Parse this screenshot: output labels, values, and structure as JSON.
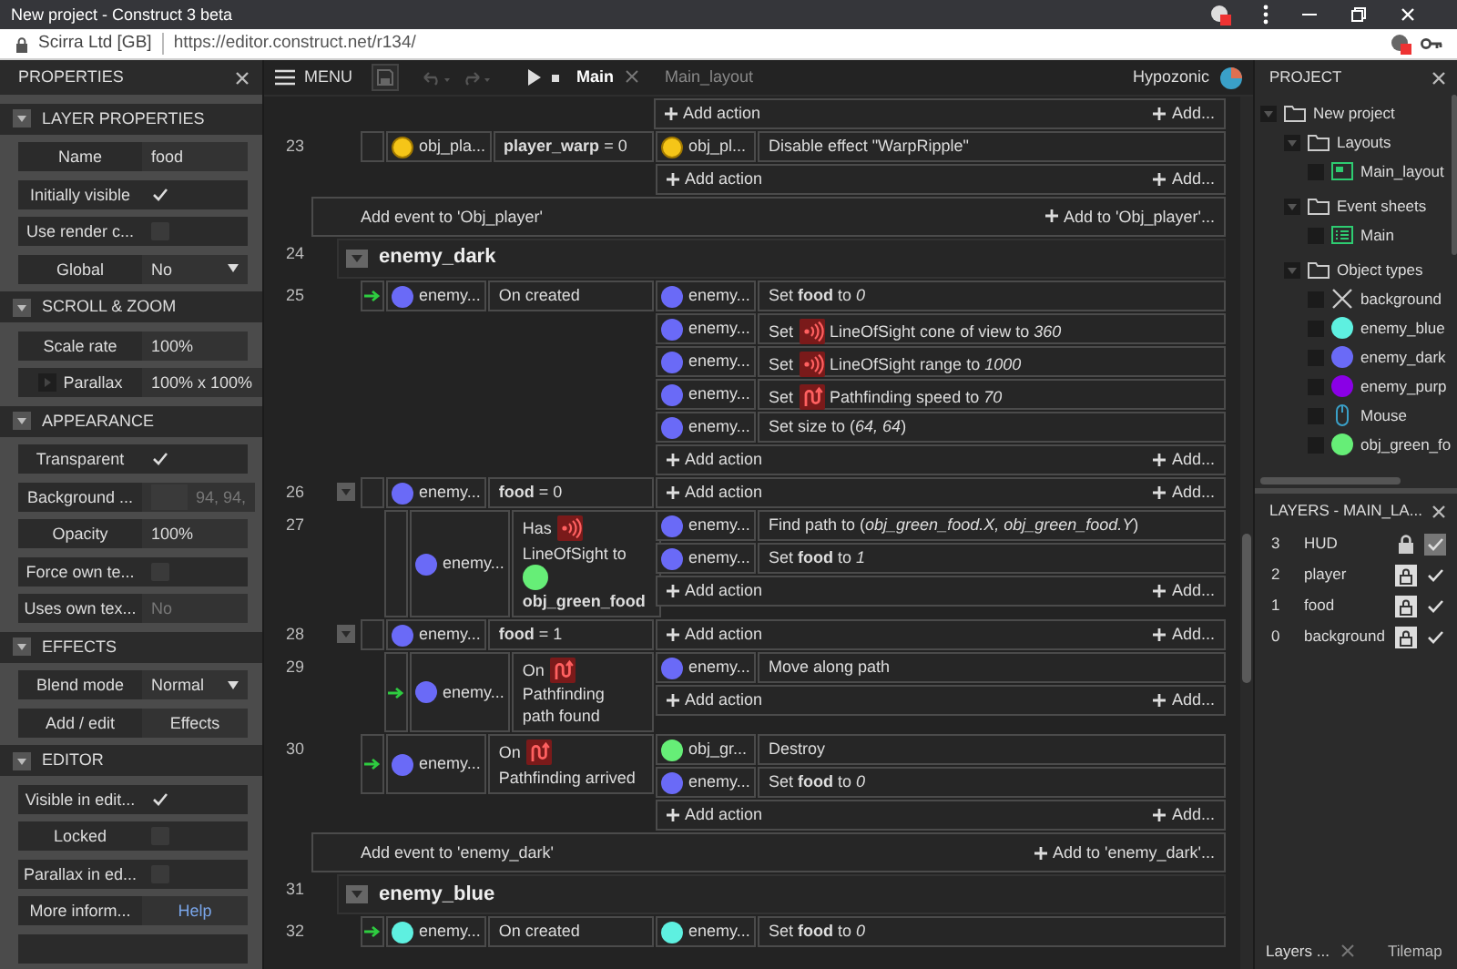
{
  "browser": {
    "title": "New project - Construct 3 beta",
    "site": "Scirra Ltd [GB]",
    "url": "https://editor.construct.net/r134/"
  },
  "properties": {
    "title": "PROPERTIES",
    "sections": [
      {
        "title": "LAYER PROPERTIES",
        "expanded": true,
        "rows": [
          {
            "kind": "text",
            "label": "Name",
            "value": "food",
            "disabled": false
          },
          {
            "kind": "check",
            "label": "Initially visible",
            "checked": true,
            "disabled": false
          },
          {
            "kind": "check",
            "label": "Use render c...",
            "checked": false,
            "disabled": false
          },
          {
            "kind": "select",
            "label": "Global",
            "value": "No",
            "disabled": false
          }
        ]
      },
      {
        "title": "SCROLL & ZOOM",
        "expanded": true,
        "rows": [
          {
            "kind": "text",
            "label": "Scale rate",
            "value": "100%",
            "disabled": false
          },
          {
            "kind": "group",
            "label": "Parallax",
            "value": "100% x 100%",
            "expanded": false,
            "disabled": false
          }
        ]
      },
      {
        "title": "APPEARANCE",
        "expanded": true,
        "rows": [
          {
            "kind": "check",
            "label": "Transparent",
            "checked": true,
            "disabled": false
          },
          {
            "kind": "color",
            "label": "Background ...",
            "value": "94, 94,",
            "disabled": true
          },
          {
            "kind": "text",
            "label": "Opacity",
            "value": "100%",
            "disabled": false
          },
          {
            "kind": "check",
            "label": "Force own te...",
            "checked": false,
            "disabled": false
          },
          {
            "kind": "text",
            "label": "Uses own tex...",
            "value": "No",
            "disabled": true
          }
        ]
      },
      {
        "title": "EFFECTS",
        "expanded": true,
        "rows": [
          {
            "kind": "select",
            "label": "Blend mode",
            "value": "Normal",
            "disabled": false
          },
          {
            "kind": "button",
            "label": "Add / edit",
            "value": "Effects",
            "disabled": false
          }
        ]
      },
      {
        "title": "EDITOR",
        "expanded": true,
        "rows": [
          {
            "kind": "check",
            "label": "Visible in edit...",
            "checked": true,
            "disabled": false
          },
          {
            "kind": "check",
            "label": "Locked",
            "checked": false,
            "disabled": false
          },
          {
            "kind": "check",
            "label": "Parallax in ed...",
            "checked": false,
            "disabled": false
          },
          {
            "kind": "link",
            "label": "More inform...",
            "value": "Help",
            "disabled": false
          }
        ]
      }
    ]
  },
  "toolbar": {
    "menu": "MENU",
    "tabs": [
      {
        "label": "Main",
        "selected": true
      },
      {
        "label": "Main_layout",
        "selected": false
      }
    ],
    "user": "Hypozonic"
  },
  "sheet": {
    "items": [
      {
        "kind": "group-end",
        "children": [
          {
            "kind": "strip",
            "add": [
              "Add action",
              "Add..."
            ]
          },
          {
            "kind": "event",
            "number": "23",
            "trigger": false,
            "conditions": [
              {
                "object": {
                  "kind": "sprite",
                  "name": "obj_pla..."
                },
                "text": "**player_warp** = 0"
              }
            ],
            "actions": [
              {
                "object": {
                  "kind": "sprite",
                  "name": "obj_pl..."
                },
                "text": "Disable effect \"WarpRipple\""
              }
            ],
            "add": [
              "Add action",
              "Add..."
            ]
          }
        ],
        "add_event": [
          "Add event to 'Obj_player'",
          "Add to 'Obj_player'..."
        ]
      },
      {
        "kind": "group",
        "number": "24",
        "title": "enemy_dark",
        "expanded": true,
        "children": [
          {
            "kind": "event",
            "number": "25",
            "trigger": true,
            "conditions": [
              {
                "object": {
                  "kind": "circle",
                  "color": "#6a6af7",
                  "name": "enemy..."
                },
                "text": "On created"
              }
            ],
            "actions": [
              {
                "object": {
                  "kind": "circle",
                  "color": "#6a6af7",
                  "name": "enemy..."
                },
                "text": "Set **food** to *0*"
              },
              {
                "object": {
                  "kind": "circle",
                  "color": "#6a6af7",
                  "name": "enemy..."
                },
                "parts": [
                  {
                    "kind": "text",
                    "text": "Set"
                  },
                  {
                    "kind": "sight"
                  },
                  {
                    "kind": "text",
                    "text": "LineOfSight cone of view to *360*"
                  }
                ]
              },
              {
                "object": {
                  "kind": "circle",
                  "color": "#6a6af7",
                  "name": "enemy..."
                },
                "parts": [
                  {
                    "kind": "text",
                    "text": "Set"
                  },
                  {
                    "kind": "sight"
                  },
                  {
                    "kind": "text",
                    "text": "LineOfSight range to *1000*"
                  }
                ]
              },
              {
                "object": {
                  "kind": "circle",
                  "color": "#6a6af7",
                  "name": "enemy..."
                },
                "parts": [
                  {
                    "kind": "text",
                    "text": "Set"
                  },
                  {
                    "kind": "path"
                  },
                  {
                    "kind": "text",
                    "text": "Pathfinding speed to *70*"
                  }
                ]
              },
              {
                "object": {
                  "kind": "circle",
                  "color": "#6a6af7",
                  "name": "enemy..."
                },
                "text": "Set size to (*64, 64*)"
              }
            ],
            "add": [
              "Add action",
              "Add..."
            ]
          },
          {
            "kind": "event",
            "number": "26",
            "expanded": true,
            "trigger": false,
            "conditions": [
              {
                "object": {
                  "kind": "circle",
                  "color": "#6a6af7",
                  "name": "enemy..."
                },
                "text": "**food** = 0"
              }
            ],
            "add": [
              "Add action",
              "Add..."
            ],
            "children": [
              {
                "kind": "event",
                "number": "27",
                "trigger": false,
                "conditions": [
                  {
                    "object": {
                      "kind": "circle",
                      "color": "#6a6af7",
                      "name": "enemy..."
                    },
                    "parts": [
                      {
                        "kind": "text",
                        "text": "Has"
                      },
                      {
                        "kind": "sight"
                      },
                      {
                        "kind": "text",
                        "text": "LineOfSight to"
                      },
                      {
                        "kind": "object",
                        "color": "#66ee77"
                      },
                      {
                        "kind": "text",
                        "text": "**obj_green_food**"
                      }
                    ]
                  }
                ],
                "actions": [
                  {
                    "object": {
                      "kind": "circle",
                      "color": "#6a6af7",
                      "name": "enemy..."
                    },
                    "text": "Find path to (*obj_green_food.X, obj_green_food.Y*)"
                  },
                  {
                    "object": {
                      "kind": "circle",
                      "color": "#6a6af7",
                      "name": "enemy..."
                    },
                    "text": "Set **food** to *1*"
                  }
                ],
                "add": [
                  "Add action",
                  "Add..."
                ]
              }
            ]
          },
          {
            "kind": "event",
            "number": "28",
            "expanded": true,
            "trigger": false,
            "conditions": [
              {
                "object": {
                  "kind": "circle",
                  "color": "#6a6af7",
                  "name": "enemy..."
                },
                "text": "**food** = 1"
              }
            ],
            "add": [
              "Add action",
              "Add..."
            ],
            "children": [
              {
                "kind": "event",
                "number": "29",
                "trigger": true,
                "conditions": [
                  {
                    "object": {
                      "kind": "circle",
                      "color": "#6a6af7",
                      "name": "enemy..."
                    },
                    "parts": [
                      {
                        "kind": "text",
                        "text": "On"
                      },
                      {
                        "kind": "path"
                      },
                      {
                        "kind": "text",
                        "text": "Pathfinding path found"
                      }
                    ]
                  }
                ],
                "actions": [
                  {
                    "object": {
                      "kind": "circle",
                      "color": "#6a6af7",
                      "name": "enemy..."
                    },
                    "text": "Move along path"
                  }
                ],
                "add": [
                  "Add action",
                  "Add..."
                ]
              }
            ]
          },
          {
            "kind": "event",
            "number": "30",
            "trigger": true,
            "conditions": [
              {
                "object": {
                  "kind": "circle",
                  "color": "#6a6af7",
                  "name": "enemy..."
                },
                "parts": [
                  {
                    "kind": "text",
                    "text": "On"
                  },
                  {
                    "kind": "path"
                  },
                  {
                    "kind": "text",
                    "text": "Pathfinding arrived"
                  }
                ]
              }
            ],
            "actions": [
              {
                "object": {
                  "kind": "circle",
                  "color": "#66ee77",
                  "name": "obj_gr..."
                },
                "text": "Destroy"
              },
              {
                "object": {
                  "kind": "circle",
                  "color": "#6a6af7",
                  "name": "enemy..."
                },
                "text": "Set **food** to *0*"
              }
            ],
            "add": [
              "Add action",
              "Add..."
            ]
          }
        ],
        "add_event": [
          "Add event to 'enemy_dark'",
          "Add to 'enemy_dark'..."
        ]
      },
      {
        "kind": "group",
        "number": "31",
        "title": "enemy_blue",
        "expanded": true,
        "children": [
          {
            "kind": "event",
            "number": "32",
            "trigger": true,
            "conditions": [
              {
                "object": {
                  "kind": "circle",
                  "color": "#5ef0e0",
                  "name": "enemy..."
                },
                "text": "On created"
              }
            ],
            "actions": [
              {
                "object": {
                  "kind": "circle",
                  "color": "#5ef0e0",
                  "name": "enemy..."
                },
                "text": "Set **food** to *0*"
              }
            ]
          }
        ]
      }
    ]
  },
  "project": {
    "title": "PROJECT",
    "tree": [
      {
        "label": "New project",
        "kind": "folder",
        "expanded": true,
        "children": [
          {
            "label": "Layouts",
            "kind": "folder",
            "expanded": true,
            "children": [
              {
                "label": "Main_layout",
                "kind": "layout"
              }
            ]
          },
          {
            "label": "Event sheets",
            "kind": "folder",
            "expanded": true,
            "children": [
              {
                "label": "Main",
                "kind": "eventsheet"
              }
            ]
          },
          {
            "label": "Object types",
            "kind": "folder",
            "expanded": true,
            "children": [
              {
                "label": "background",
                "kind": "tiled"
              },
              {
                "label": "enemy_blue",
                "kind": "circle",
                "color": "#5ef0e0"
              },
              {
                "label": "enemy_dark",
                "kind": "circle",
                "color": "#6a6af7"
              },
              {
                "label": "enemy_purp",
                "kind": "circle",
                "color": "#8a00e6"
              },
              {
                "label": "Mouse",
                "kind": "mouse"
              },
              {
                "label": "obj_green_fo",
                "kind": "circle",
                "color": "#66ee77"
              }
            ]
          }
        ]
      }
    ]
  },
  "layers": {
    "title": "LAYERS - MAIN_LA...",
    "rows": [
      {
        "index": "3",
        "name": "HUD",
        "locked": true,
        "visible": true
      },
      {
        "index": "2",
        "name": "player",
        "locked": false,
        "visible": true
      },
      {
        "index": "1",
        "name": "food",
        "locked": false,
        "visible": true
      },
      {
        "index": "0",
        "name": "background",
        "locked": false,
        "visible": true
      }
    ],
    "tabs": [
      {
        "label": "Layers ...",
        "selected": true
      },
      {
        "label": "Tilemap",
        "selected": false
      }
    ]
  }
}
